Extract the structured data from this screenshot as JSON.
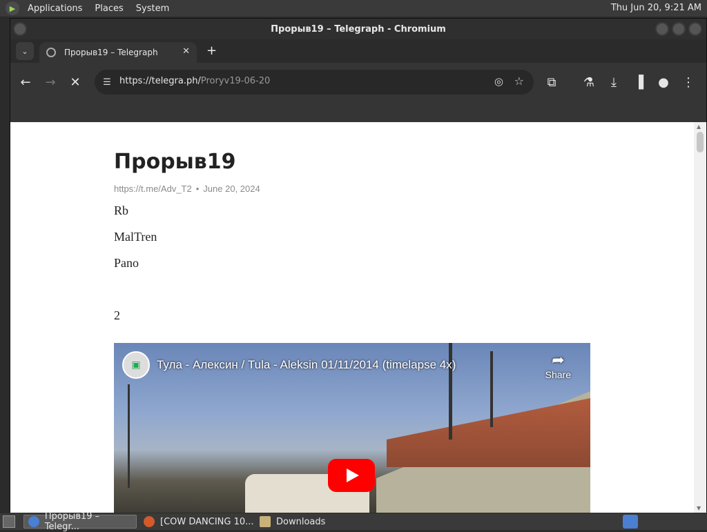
{
  "topbar": {
    "menus": [
      "Applications",
      "Places",
      "System"
    ],
    "clock": "Thu Jun 20,  9:21 AM"
  },
  "window": {
    "title": "Прорыв19 – Telegraph - Chromium"
  },
  "tab": {
    "title": "Прорыв19 – Telegraph",
    "close": "✕",
    "new": "+"
  },
  "omnibox": {
    "url_host": "https://telegra.ph/",
    "url_path": "Proryv19-06-20"
  },
  "toolbar_icons": [
    "back-arrow-icon",
    "forward-arrow-icon",
    "stop-loading-icon",
    "site-settings-icon",
    "eye-off-icon",
    "star-icon",
    "extensions-icon",
    "labs-flask-icon",
    "download-icon",
    "side-panel-icon",
    "profile-icon",
    "kebab-menu-icon"
  ],
  "article": {
    "title": "Прорыв19",
    "author": "https://t.me/Adv_T2",
    "date": "June 20, 2024",
    "paragraphs": [
      "Rb",
      "MalTren",
      "Pano",
      "",
      "2"
    ]
  },
  "video": {
    "title": "Тула - Алексин / Tula - Aleksin 01/11/2014 (timelapse 4x)",
    "share": "Share"
  },
  "taskbar": {
    "items": [
      "Прорыв19 – Telegr...",
      "[COW DANCING 10...",
      "Downloads"
    ]
  }
}
